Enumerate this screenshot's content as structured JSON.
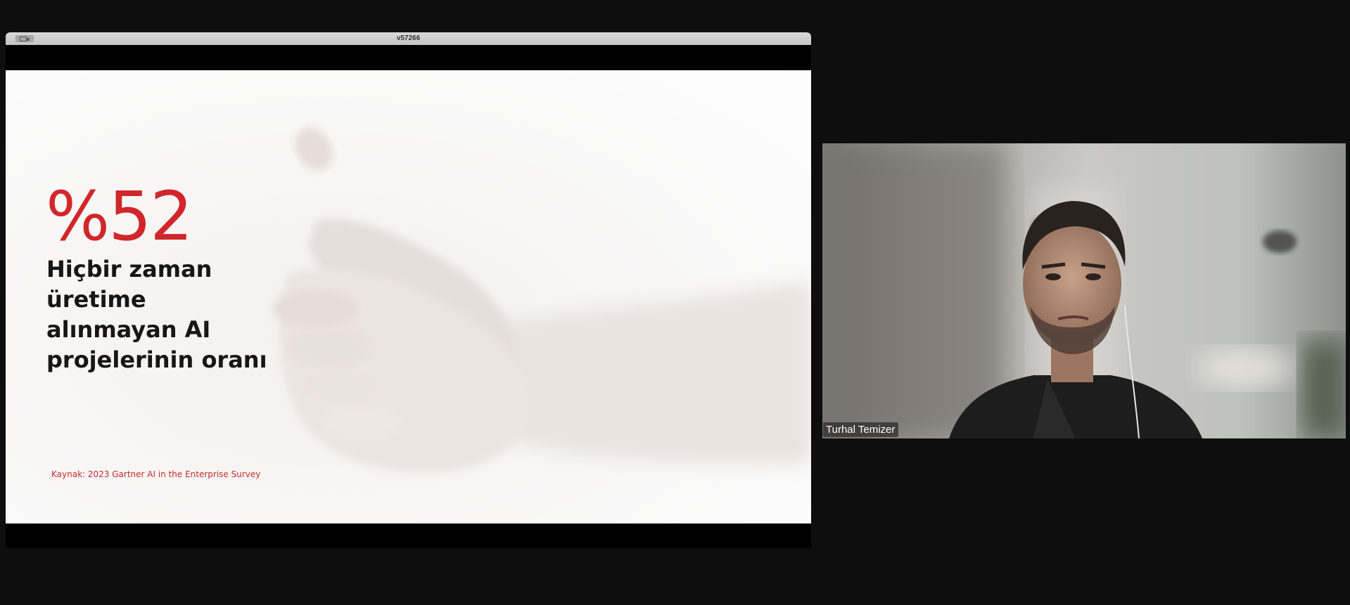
{
  "share_window": {
    "title": "v57266"
  },
  "slide": {
    "stat": "%52",
    "description_lines": [
      "Hiçbir zaman",
      "üretime",
      "alınmayan AI",
      "projelerinin oranı"
    ],
    "source": "Kaynak: 2023 Gartner AI in the Enterprise Survey",
    "accent_color": "#d1262a"
  },
  "participant": {
    "name": "Turhal Temizer"
  },
  "icons": {
    "share_view_button": "view-options-icon"
  }
}
